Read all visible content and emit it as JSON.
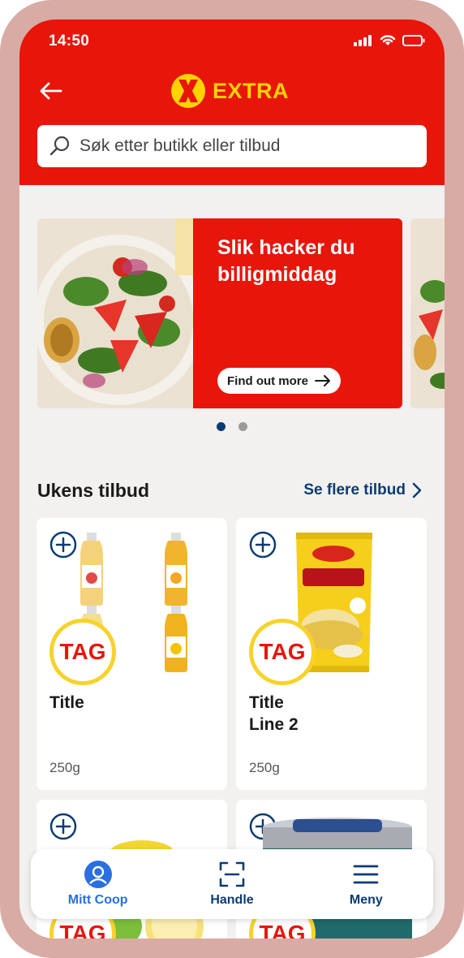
{
  "status": {
    "time": "14:50"
  },
  "header": {
    "brand": "EXTRA"
  },
  "search": {
    "placeholder": "Søk etter butikk eller tilbud"
  },
  "banner": {
    "title": "Slik hacker du billigmiddag",
    "cta": "Find out more"
  },
  "carousel": {
    "pages": 2,
    "active_index": 0
  },
  "offers": {
    "title": "Ukens tilbud",
    "see_more": "Se flere tilbud",
    "cards": [
      {
        "tag": "TAG",
        "title": "Title",
        "weight": "250g"
      },
      {
        "tag": "TAG",
        "title_line1": "Title",
        "title_line2": "Line 2",
        "weight": "250g"
      },
      {
        "tag": "TAG"
      },
      {
        "tag": "TAG"
      }
    ]
  },
  "bottom_nav": {
    "items": [
      {
        "label": "Mitt Coop",
        "icon": "user-icon",
        "active": true
      },
      {
        "label": "Handle",
        "icon": "scan-icon"
      },
      {
        "label": "Meny",
        "icon": "menu-icon"
      }
    ]
  },
  "colors": {
    "brand_red": "#e8150b",
    "brand_yellow": "#ffd300",
    "navy": "#0d3b73",
    "active_blue": "#2a6ee0"
  }
}
